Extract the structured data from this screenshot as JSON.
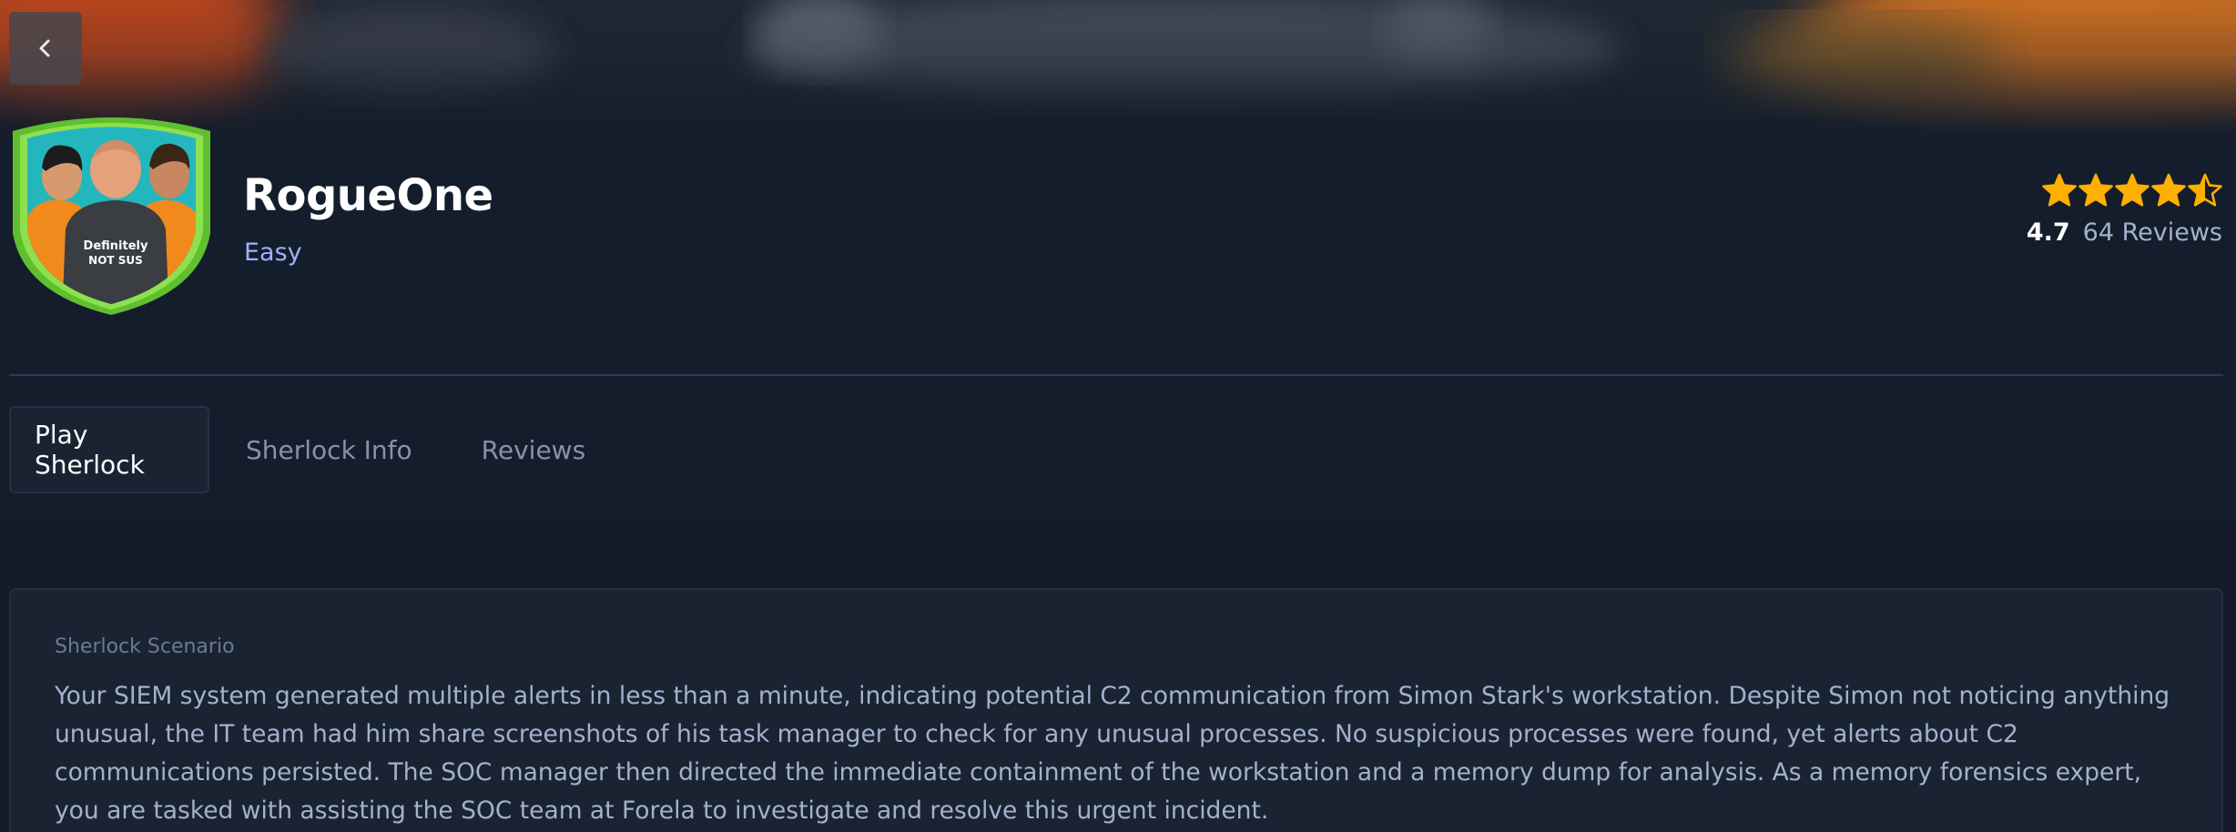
{
  "header": {
    "back_icon": "chevron-left-icon",
    "title": "RogueOne",
    "difficulty": "Easy",
    "badge_text_line1": "Definitely",
    "badge_text_line2": "NOT SUS"
  },
  "rating": {
    "stars": 4.5,
    "max_stars": 5,
    "value": "4.7",
    "reviews": "64 Reviews"
  },
  "tabs": [
    {
      "label": "Play Sherlock",
      "active": true
    },
    {
      "label": "Sherlock Info",
      "active": false
    },
    {
      "label": "Reviews",
      "active": false
    }
  ],
  "scenario": {
    "label": "Sherlock Scenario",
    "text": "Your SIEM system generated multiple alerts in less than a minute, indicating potential C2 communication from Simon Stark's workstation. Despite Simon not noticing anything unusual, the IT team had him share screenshots of his task manager to check for any unusual processes. No suspicious processes were found, yet alerts about C2 communications persisted. The SOC manager then directed the immediate containment of the workstation and a memory dump for analysis. As a memory forensics expert, you are tasked with assisting the SOC team at Forela to investigate and resolve this urgent incident."
  },
  "colors": {
    "background": "#141d2b",
    "accent_difficulty": "#9fb0ff",
    "star": "#ffaf00",
    "badge_border": "#7ed957"
  }
}
